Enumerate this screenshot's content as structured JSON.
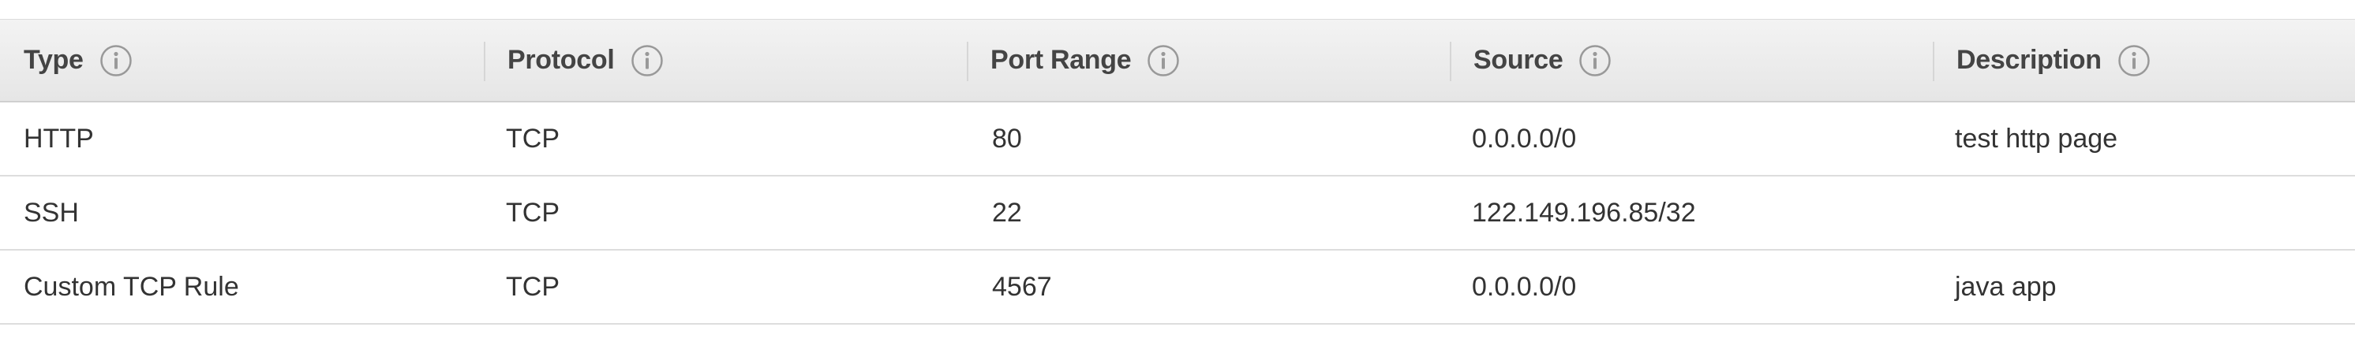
{
  "table": {
    "columns": [
      {
        "label": "Type",
        "icon": "info-icon"
      },
      {
        "label": "Protocol",
        "icon": "info-icon"
      },
      {
        "label": "Port Range",
        "icon": "info-icon"
      },
      {
        "label": "Source",
        "icon": "info-icon"
      },
      {
        "label": "Description",
        "icon": "info-icon"
      }
    ],
    "rows": [
      [
        "HTTP",
        "TCP",
        "80",
        "0.0.0.0/0",
        "test http page"
      ],
      [
        "SSH",
        "TCP",
        "22",
        "122.149.196.85/32",
        ""
      ],
      [
        "Custom TCP Rule",
        "TCP",
        "4567",
        "0.0.0.0/0",
        "java app"
      ]
    ]
  },
  "colors": {
    "header_bg": "#e9e9e9",
    "text": "#333333",
    "icon": "#999999"
  }
}
